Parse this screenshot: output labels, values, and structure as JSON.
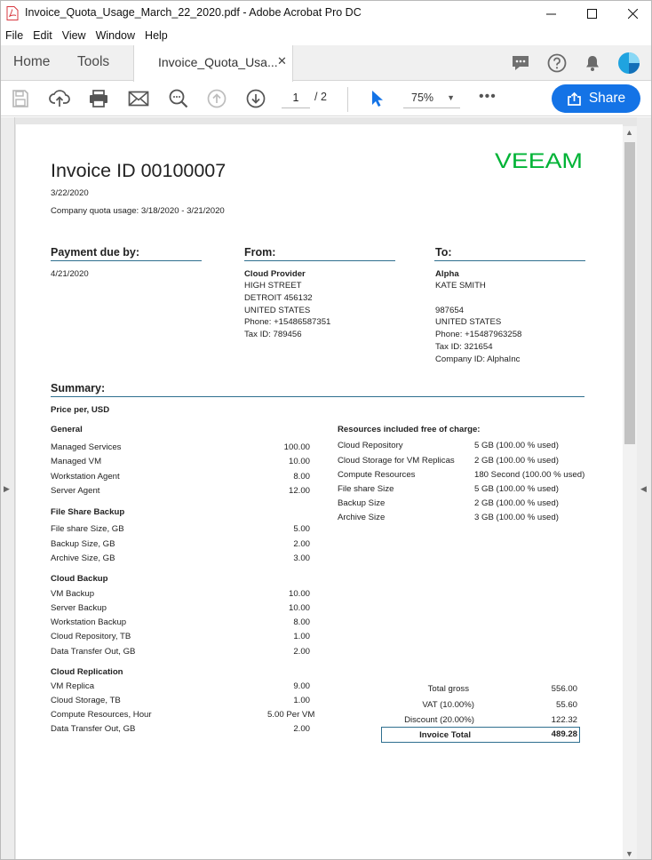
{
  "window": {
    "title": "Invoice_Quota_Usage_March_22_2020.pdf - Adobe Acrobat Pro DC",
    "minimize": "—",
    "maximize": "☐",
    "close": "✕"
  },
  "menu": [
    "File",
    "Edit",
    "View",
    "Window",
    "Help"
  ],
  "tabs": {
    "home": "Home",
    "tools": "Tools",
    "document": "Invoice_Quota_Usa...",
    "close": "✕"
  },
  "toolbar": {
    "page_current": "1",
    "page_total": "/  2",
    "zoom": "75%",
    "more": "•••",
    "share_label": "Share"
  },
  "colors": {
    "accent": "#1473e6",
    "rule": "#2f6f8f",
    "brand": "#00b336"
  },
  "invoice": {
    "title": "Invoice ID 00100007",
    "date": "3/22/2020",
    "usage_period": "Company quota usage: 3/18/2020 - 3/21/2020",
    "brand": "VEEAM",
    "payment": {
      "header": "Payment due by:",
      "date": "4/21/2020"
    },
    "from": {
      "header": "From:",
      "name": "Cloud Provider",
      "lines": [
        "HIGH STREET",
        "DETROIT 456132",
        "UNITED STATES",
        "Phone: +15486587351",
        "Tax ID: 789456"
      ]
    },
    "to": {
      "header": "To:",
      "name": "Alpha",
      "lines": [
        "KATE SMITH",
        "",
        "987654",
        "UNITED STATES",
        "Phone: +15487963258",
        "Tax ID: 321654",
        "Company ID: AlphaInc"
      ]
    },
    "summary": {
      "header": "Summary:",
      "price_per": "Price per, USD",
      "sections": [
        {
          "title": "General",
          "items": [
            {
              "label": "Managed Services",
              "value": "100.00"
            },
            {
              "label": "Managed VM",
              "value": "10.00"
            },
            {
              "label": "Workstation Agent",
              "value": "8.00"
            },
            {
              "label": "Server Agent",
              "value": "12.00"
            }
          ]
        },
        {
          "title": "File Share Backup",
          "items": [
            {
              "label": "File share Size, GB",
              "value": "5.00"
            },
            {
              "label": "Backup Size, GB",
              "value": "2.00"
            },
            {
              "label": "Archive Size, GB",
              "value": "3.00"
            }
          ]
        },
        {
          "title": "Cloud Backup",
          "items": [
            {
              "label": "VM Backup",
              "value": "10.00"
            },
            {
              "label": "Server Backup",
              "value": "10.00"
            },
            {
              "label": "Workstation Backup",
              "value": "8.00"
            },
            {
              "label": "Cloud Repository, TB",
              "value": "1.00"
            },
            {
              "label": "Data Transfer Out, GB",
              "value": "2.00"
            }
          ]
        },
        {
          "title": "Cloud Replication",
          "items": [
            {
              "label": "VM Replica",
              "value": "9.00"
            },
            {
              "label": "Cloud Storage, TB",
              "value": "1.00"
            },
            {
              "label": "Compute Resources, Hour",
              "value": "5.00 Per VM"
            },
            {
              "label": "Data Transfer Out, GB",
              "value": "2.00"
            }
          ]
        }
      ],
      "free": {
        "title": "Resources included free of charge:",
        "items": [
          {
            "label": "Cloud Repository",
            "value": "5 GB (100.00 % used)"
          },
          {
            "label": "Cloud Storage for VM Replicas",
            "value": "2 GB (100.00 % used)"
          },
          {
            "label": "Compute Resources",
            "value": "180 Second (100.00 % used)"
          },
          {
            "label": "File share Size",
            "value": "5 GB (100.00 % used)"
          },
          {
            "label": "Backup Size",
            "value": "2 GB (100.00 % used)"
          },
          {
            "label": "Archive Size",
            "value": "3 GB (100.00 % used)"
          }
        ]
      },
      "totals": {
        "gross_label": "Total gross",
        "gross_value": "556.00",
        "vat_label": "VAT (10.00%)",
        "vat_value": "55.60",
        "discount_label": "Discount (20.00%)",
        "discount_value": "122.32",
        "total_label": "Invoice Total",
        "total_value": "489.28"
      }
    }
  }
}
